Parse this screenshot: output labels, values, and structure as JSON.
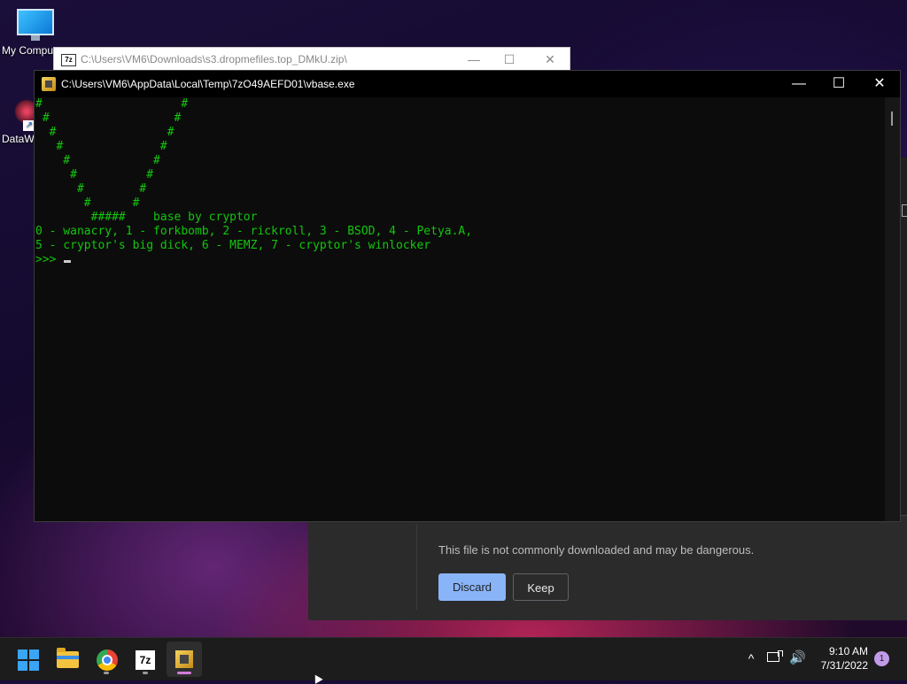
{
  "desktop": {
    "icons": [
      {
        "label": "My Compu"
      },
      {
        "label": "DataW"
      }
    ]
  },
  "background_window": {
    "icon_text": "7z",
    "title": "C:\\Users\\VM6\\Downloads\\s3.dropmefiles.top_DMkU.zip\\",
    "minimize": "—",
    "maximize": "☐",
    "close": "✕"
  },
  "console": {
    "title": "C:\\Users\\VM6\\AppData\\Local\\Temp\\7zO49AEFD01\\vbase.exe",
    "minimize": "—",
    "maximize": "☐",
    "close": "✕",
    "output": "#                    #\n #                  #\n  #                #\n   #              #\n    #            #\n     #          #\n      #        #\n       #      #\n        #####    base by cryptor\n0 - wanacry, 1 - forkbomb, 2 - rickroll, 3 - BSOD, 4 - Petya.A,\n5 - cryptor's big dick, 6 - MEMZ, 7 - cryptor's winlocker\n>>> ",
    "text_color": "#13c60d"
  },
  "download_warning": {
    "message": "This file is not commonly downloaded and may be dangerous.",
    "discard_label": "Discard",
    "keep_label": "Keep"
  },
  "taskbar": {
    "items": [
      {
        "name": "start",
        "icon": "windows-start-icon"
      },
      {
        "name": "file-explorer",
        "icon": "folder-icon"
      },
      {
        "name": "chrome",
        "icon": "chrome-icon"
      },
      {
        "name": "7zip",
        "icon": "7zip-icon",
        "icon_text": "7z"
      },
      {
        "name": "vbase",
        "icon": "console-app-icon",
        "active": true
      }
    ],
    "tray": {
      "chevron": "^",
      "volume": "🔊",
      "time": "9:10 AM",
      "date": "7/31/2022",
      "notifications": "1"
    }
  },
  "colors": {
    "accent": "#8ab4f8",
    "active_indicator": "#d27bd8"
  }
}
